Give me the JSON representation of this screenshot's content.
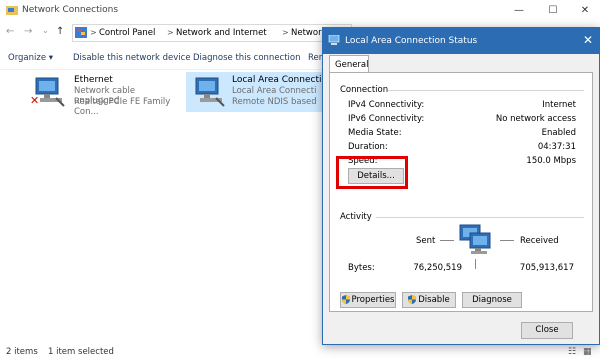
{
  "window": {
    "title": "Network Connections"
  },
  "titlebar_controls": {
    "minimize": "—",
    "maximize": "☐",
    "close": "✕"
  },
  "addressbar": {
    "crumbs": [
      "Control Panel",
      "Network and Internet",
      "Network Connecti"
    ],
    "separator": ">"
  },
  "commandbar": {
    "organize": "Organize ▾",
    "disable": "Disable this network device",
    "diagnose": "Diagnose this connection",
    "rename": "Ren",
    "help": "?"
  },
  "items": [
    {
      "name": "Ethernet",
      "status": "Network cable unplugged",
      "device": "Realtek PCIe FE Family Con..."
    },
    {
      "name": "Local Area Connecti",
      "status": "Local Area Connecti",
      "device": "Remote NDIS based"
    }
  ],
  "statusbar": {
    "count": "2 items",
    "selected": "1 item selected"
  },
  "dialog": {
    "title": "Local Area Connection Status",
    "close": "✕",
    "tab": "General",
    "connection": {
      "heading": "Connection",
      "rows": [
        {
          "label": "IPv4 Connectivity:",
          "value": "Internet"
        },
        {
          "label": "IPv6 Connectivity:",
          "value": "No network access"
        },
        {
          "label": "Media State:",
          "value": "Enabled"
        },
        {
          "label": "Duration:",
          "value": "04:37:31"
        },
        {
          "label": "Speed:",
          "value": "150.0 Mbps"
        }
      ],
      "details_button": "Details..."
    },
    "activity": {
      "heading": "Activity",
      "sent_label": "Sent",
      "received_label": "Received",
      "bytes_label": "Bytes:",
      "bytes_sent": "76,250,519",
      "bytes_received": "705,913,617"
    },
    "buttons": {
      "properties": "Properties",
      "disable": "Disable",
      "diagnose": "Diagnose",
      "close": "Close"
    }
  },
  "colors": {
    "accent": "#2b6cb3",
    "highlight": "#e00000",
    "selection": "#cce8ff"
  }
}
